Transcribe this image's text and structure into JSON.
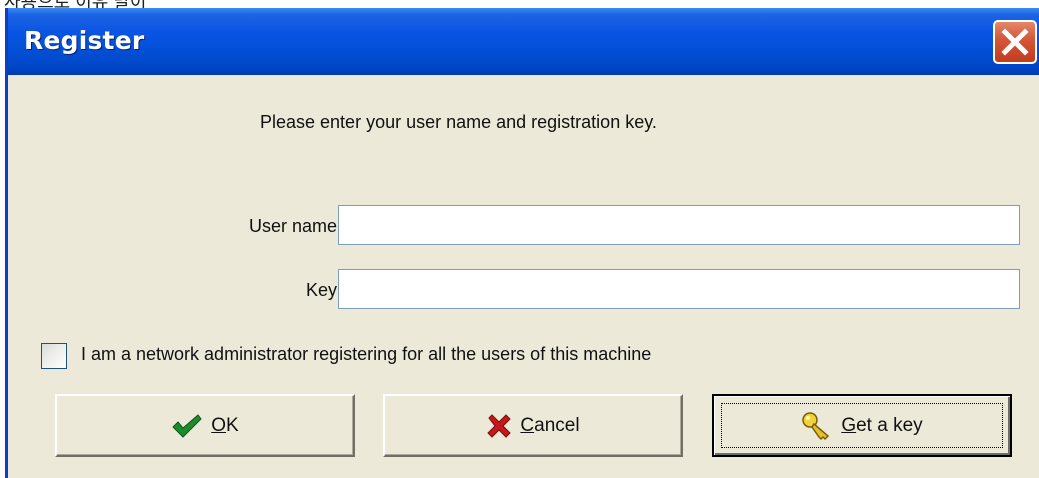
{
  "window": {
    "title": "Register",
    "accent_color": "#0a55e4",
    "close_icon": "close-icon"
  },
  "form": {
    "prompt": "Please enter your user name and registration key.",
    "username_label": "User name:",
    "username_value": "",
    "key_label": "Key:",
    "key_value": "",
    "admin_checkbox_checked": false,
    "admin_checkbox_label": "I am a network administrator registering for all the users of this machine"
  },
  "buttons": {
    "ok": {
      "icon": "checkmark-icon",
      "mnemonic": "O",
      "rest": "K"
    },
    "cancel": {
      "icon": "x-mark-icon",
      "mnemonic": "C",
      "rest": "ancel"
    },
    "get_key": {
      "icon": "key-icon",
      "mnemonic": "G",
      "rest": "et a key",
      "focused": true
    }
  }
}
